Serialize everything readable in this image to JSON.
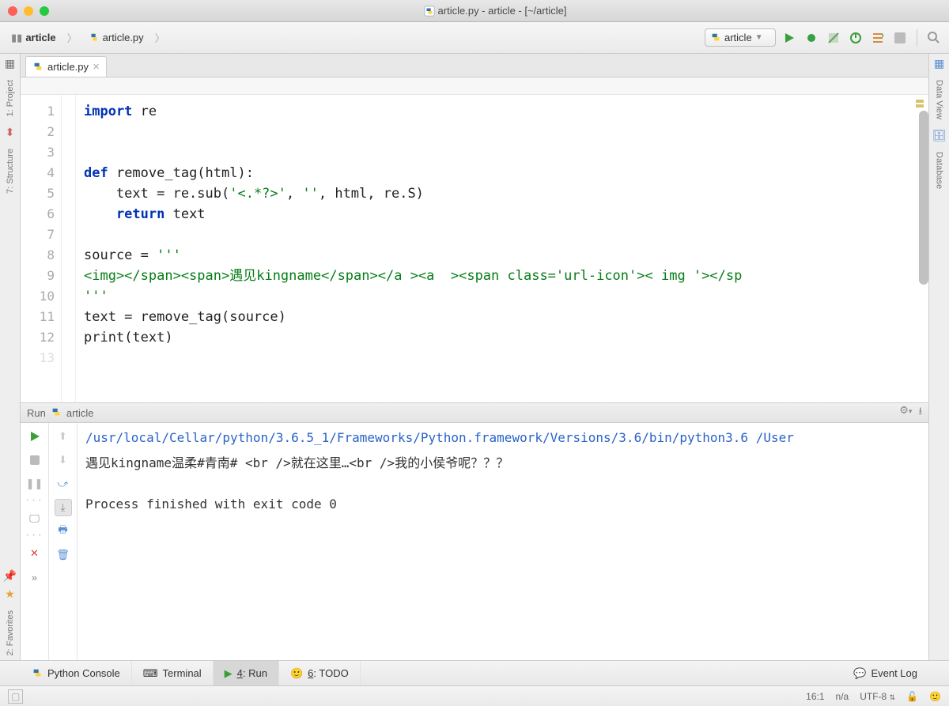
{
  "titlebar": {
    "title": "article.py - article - [~/article]"
  },
  "breadcrumb": {
    "items": [
      "article",
      "article.py"
    ]
  },
  "run_config": {
    "label": "article"
  },
  "editor_tab": {
    "label": "article.py"
  },
  "sidebar_left": {
    "project": "1: Project",
    "structure": "7: Structure",
    "favorites": "2: Favorites"
  },
  "sidebar_right": {
    "dataview": "Data View",
    "database": "Database"
  },
  "editor": {
    "lines": [
      "1",
      "2",
      "3",
      "4",
      "5",
      "6",
      "7",
      "8",
      "9",
      "10",
      "11",
      "12",
      "13"
    ],
    "line1_kw": "import",
    "line1_rest": " re",
    "line4_kw": "def",
    "line4_rest": " remove_tag(html):",
    "line5_a": "    text = re.sub(",
    "line5_s1": "'<.*?>'",
    "line5_b": ", ",
    "line5_s2": "''",
    "line5_c": ", html, re.S)",
    "line6_kw": "    return",
    "line6_rest": " text",
    "line8": "source = ",
    "line8_s": "'''",
    "line9": "<img></span><span>遇见kingname</span></a ><a  ><span class='url-icon'>< img '></sp",
    "line10": "'''",
    "line11": "text = remove_tag(source)",
    "line12_a": "print",
    "line12_b": "(text)"
  },
  "run_panel": {
    "title_label": "Run",
    "title_config": "article",
    "console_line1": "/usr/local/Cellar/python/3.6.5_1/Frameworks/Python.framework/Versions/3.6/bin/python3.6 /User",
    "console_line2": "遇见kingname温柔#青南# <br />就在这里…<br />我的小侯爷呢？？？",
    "console_line3": "Process finished with exit code 0"
  },
  "bottom_tabs": {
    "python_console": "Python Console",
    "terminal": "Terminal",
    "run": "4: Run",
    "todo": "6: TODO",
    "event_log": "Event Log"
  },
  "statusbar": {
    "pos": "16:1",
    "na": "n/a",
    "enc": "UTF-8"
  }
}
